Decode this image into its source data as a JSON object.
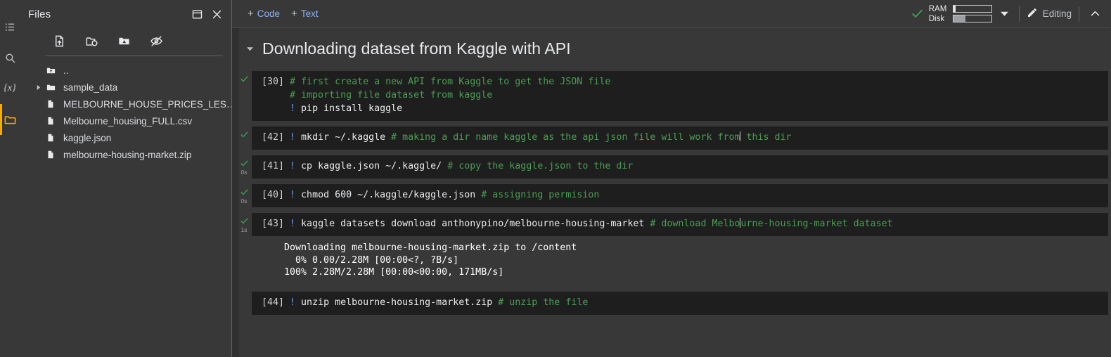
{
  "rail": {
    "items": [
      {
        "name": "table-of-contents",
        "icon": "list-icon",
        "active": false
      },
      {
        "name": "search",
        "icon": "search-icon",
        "active": false
      },
      {
        "name": "variables",
        "icon": "variables-icon",
        "label": "{x}",
        "active": false
      },
      {
        "name": "files",
        "icon": "folder-icon",
        "active": true
      }
    ],
    "active_color": "#f9ab00"
  },
  "files_panel": {
    "title": "Files",
    "header_actions": [
      {
        "label": "Open in new window",
        "icon": "new-window-icon"
      },
      {
        "label": "Close",
        "icon": "close-icon"
      }
    ],
    "toolbar": [
      {
        "label": "Upload to session storage",
        "icon": "upload-file-icon"
      },
      {
        "label": "Refresh",
        "icon": "refresh-folder-icon"
      },
      {
        "label": "Mount Drive",
        "icon": "mount-drive-icon"
      },
      {
        "label": "Show hidden files",
        "icon": "hide-eye-icon"
      }
    ],
    "items": [
      {
        "name": "..",
        "type": "parent",
        "expandable": false
      },
      {
        "name": "sample_data",
        "type": "folder",
        "expandable": true
      },
      {
        "name": "MELBOURNE_HOUSE_PRICES_LES…",
        "type": "file",
        "expandable": false
      },
      {
        "name": "Melbourne_housing_FULL.csv",
        "type": "file",
        "expandable": false
      },
      {
        "name": "kaggle.json",
        "type": "file",
        "expandable": false
      },
      {
        "name": "melbourne-housing-market.zip",
        "type": "file",
        "expandable": false
      }
    ]
  },
  "toolbar": {
    "add_code": "Code",
    "add_text": "Text",
    "plus": "+",
    "status_icon": "check-icon",
    "ram_label": "RAM",
    "disk_label": "Disk",
    "ram_fill_pct": 6,
    "disk_fill_pct": 32,
    "dropdown_icon": "chevron-down-icon",
    "editing_label": "Editing",
    "editing_icon": "pencil-icon",
    "collapse_icon": "chevron-up-icon"
  },
  "notebook": {
    "section_title": "Downloading dataset from Kaggle with API",
    "section_twisty": "chevron-down-icon",
    "cells": [
      {
        "exec_count": "[30]",
        "status": "ok",
        "runtime": "",
        "lines": [
          [
            {
              "t": "cmt",
              "v": "# first create a new API from Kaggle to get the JSON file"
            }
          ],
          [
            {
              "t": "cmt",
              "v": "# importing file dataset from kaggle"
            }
          ],
          [
            {
              "t": "bang",
              "v": "!"
            },
            {
              "t": "plain",
              "v": " pip install kaggle"
            }
          ]
        ],
        "output": []
      },
      {
        "exec_count": "[42]",
        "status": "ok",
        "runtime": "",
        "lines": [
          [
            {
              "t": "bang",
              "v": "!"
            },
            {
              "t": "plain",
              "v": " mkdir ~/.kaggle "
            },
            {
              "t": "cmt",
              "v": "# making a dir name kaggle as the api json file will work from"
            },
            {
              "t": "caret",
              "v": ""
            },
            {
              "t": "cmt",
              "v": " this dir"
            }
          ]
        ],
        "output": []
      },
      {
        "exec_count": "[41]",
        "status": "ok",
        "runtime": "0s",
        "lines": [
          [
            {
              "t": "bang",
              "v": "!"
            },
            {
              "t": "plain",
              "v": " cp kaggle.json ~/.kaggle/ "
            },
            {
              "t": "cmt",
              "v": "# copy the kaggle.json to the dir"
            }
          ]
        ],
        "output": []
      },
      {
        "exec_count": "[40]",
        "status": "ok",
        "runtime": "0s",
        "lines": [
          [
            {
              "t": "bang",
              "v": "!"
            },
            {
              "t": "plain",
              "v": " chmod 600 ~/.kaggle/kaggle.json "
            },
            {
              "t": "cmt",
              "v": "# assigning permision"
            }
          ]
        ],
        "output": []
      },
      {
        "exec_count": "[43]",
        "status": "ok",
        "runtime": "1s",
        "lines": [
          [
            {
              "t": "bang",
              "v": "!"
            },
            {
              "t": "plain",
              "v": " kaggle datasets download anthonypino/melbourne-housing-market "
            },
            {
              "t": "cmt",
              "v": "# download Melbo"
            },
            {
              "t": "caret",
              "v": ""
            },
            {
              "t": "cmt",
              "v": "urne-housing-market dataset"
            }
          ]
        ],
        "output": [
          "Downloading melbourne-housing-market.zip to /content",
          "  0% 0.00/2.28M [00:00<?, ?B/s]",
          "100% 2.28M/2.28M [00:00<00:00, 171MB/s]"
        ]
      },
      {
        "exec_count": "[44]",
        "status": "none",
        "runtime": "",
        "lines": [
          [
            {
              "t": "bang",
              "v": "!"
            },
            {
              "t": "plain",
              "v": " unzip melbourne-housing-market.zip "
            },
            {
              "t": "cmt",
              "v": "# unzip the file"
            }
          ]
        ],
        "output": []
      }
    ]
  }
}
